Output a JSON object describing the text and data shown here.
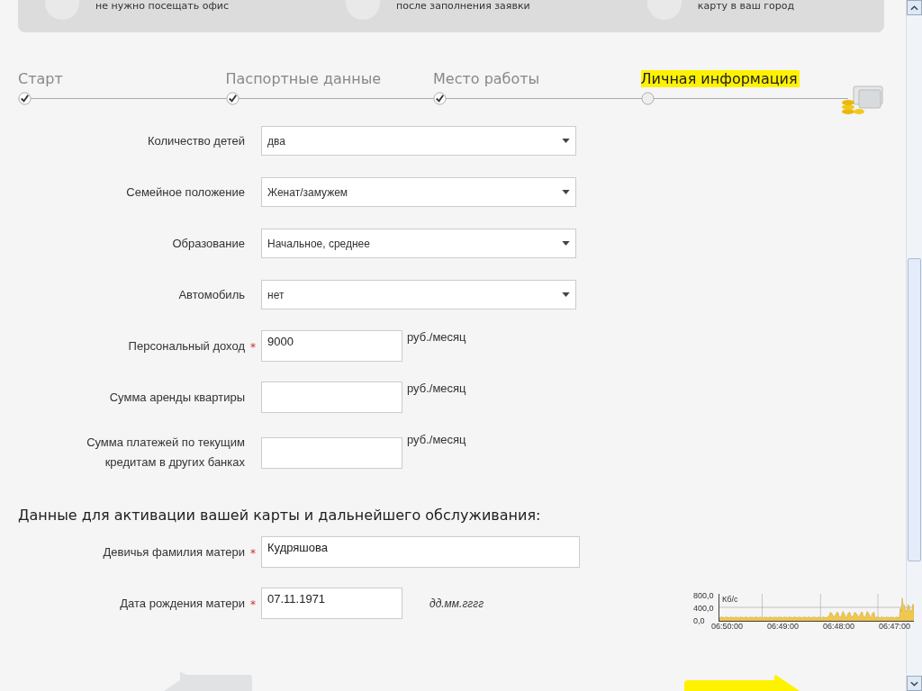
{
  "benefits": [
    {
      "text": "не нужно посещать офис"
    },
    {
      "text": "после заполнения заявки"
    },
    {
      "text": "карту в ваш город"
    }
  ],
  "steps": [
    {
      "label": "Старт",
      "done": true,
      "selected": false
    },
    {
      "label": "Паспортные данные",
      "done": true,
      "selected": false
    },
    {
      "label": "Место работы",
      "done": true,
      "selected": false
    },
    {
      "label": "Личная информация",
      "done": false,
      "selected": true
    }
  ],
  "form": [
    {
      "kind": "select",
      "label": "Количество детей",
      "value": "два"
    },
    {
      "kind": "select",
      "label": "Семейное положение",
      "value": "Женат/замужем"
    },
    {
      "kind": "select",
      "label": "Образование",
      "value": "Начальное, среднее"
    },
    {
      "kind": "select",
      "label": "Автомобиль",
      "value": "нет"
    },
    {
      "kind": "money",
      "label": "Персональный доход",
      "required_mark": "*",
      "value": "9000",
      "unit": "руб./месяц"
    },
    {
      "kind": "money",
      "label": "Сумма аренды квартиры",
      "unit": "руб./месяц"
    },
    {
      "kind": "money",
      "label": "Сумма платежей по текущим кредитам в других банках",
      "unit": "руб./месяц"
    }
  ],
  "section_title": "Данные для активации вашей карты и дальнейшего обслуживания:",
  "activation": [
    {
      "kind": "wide",
      "label": "Девичья фамилия матери",
      "required_mark": "*",
      "value": "Кудряшова"
    },
    {
      "kind": "date",
      "label": "Дата рождения матери",
      "required_mark": "*",
      "value": "07.11.1971",
      "hint": "дд.мм.гггг"
    }
  ],
  "traffic_graph": {
    "unit": "Кб/с",
    "y_labels": [
      "800,0",
      "400,0",
      "0,0"
    ],
    "x_labels": [
      "06:50:00",
      "06:49:00",
      "06:48:00",
      "06:47:00"
    ]
  }
}
